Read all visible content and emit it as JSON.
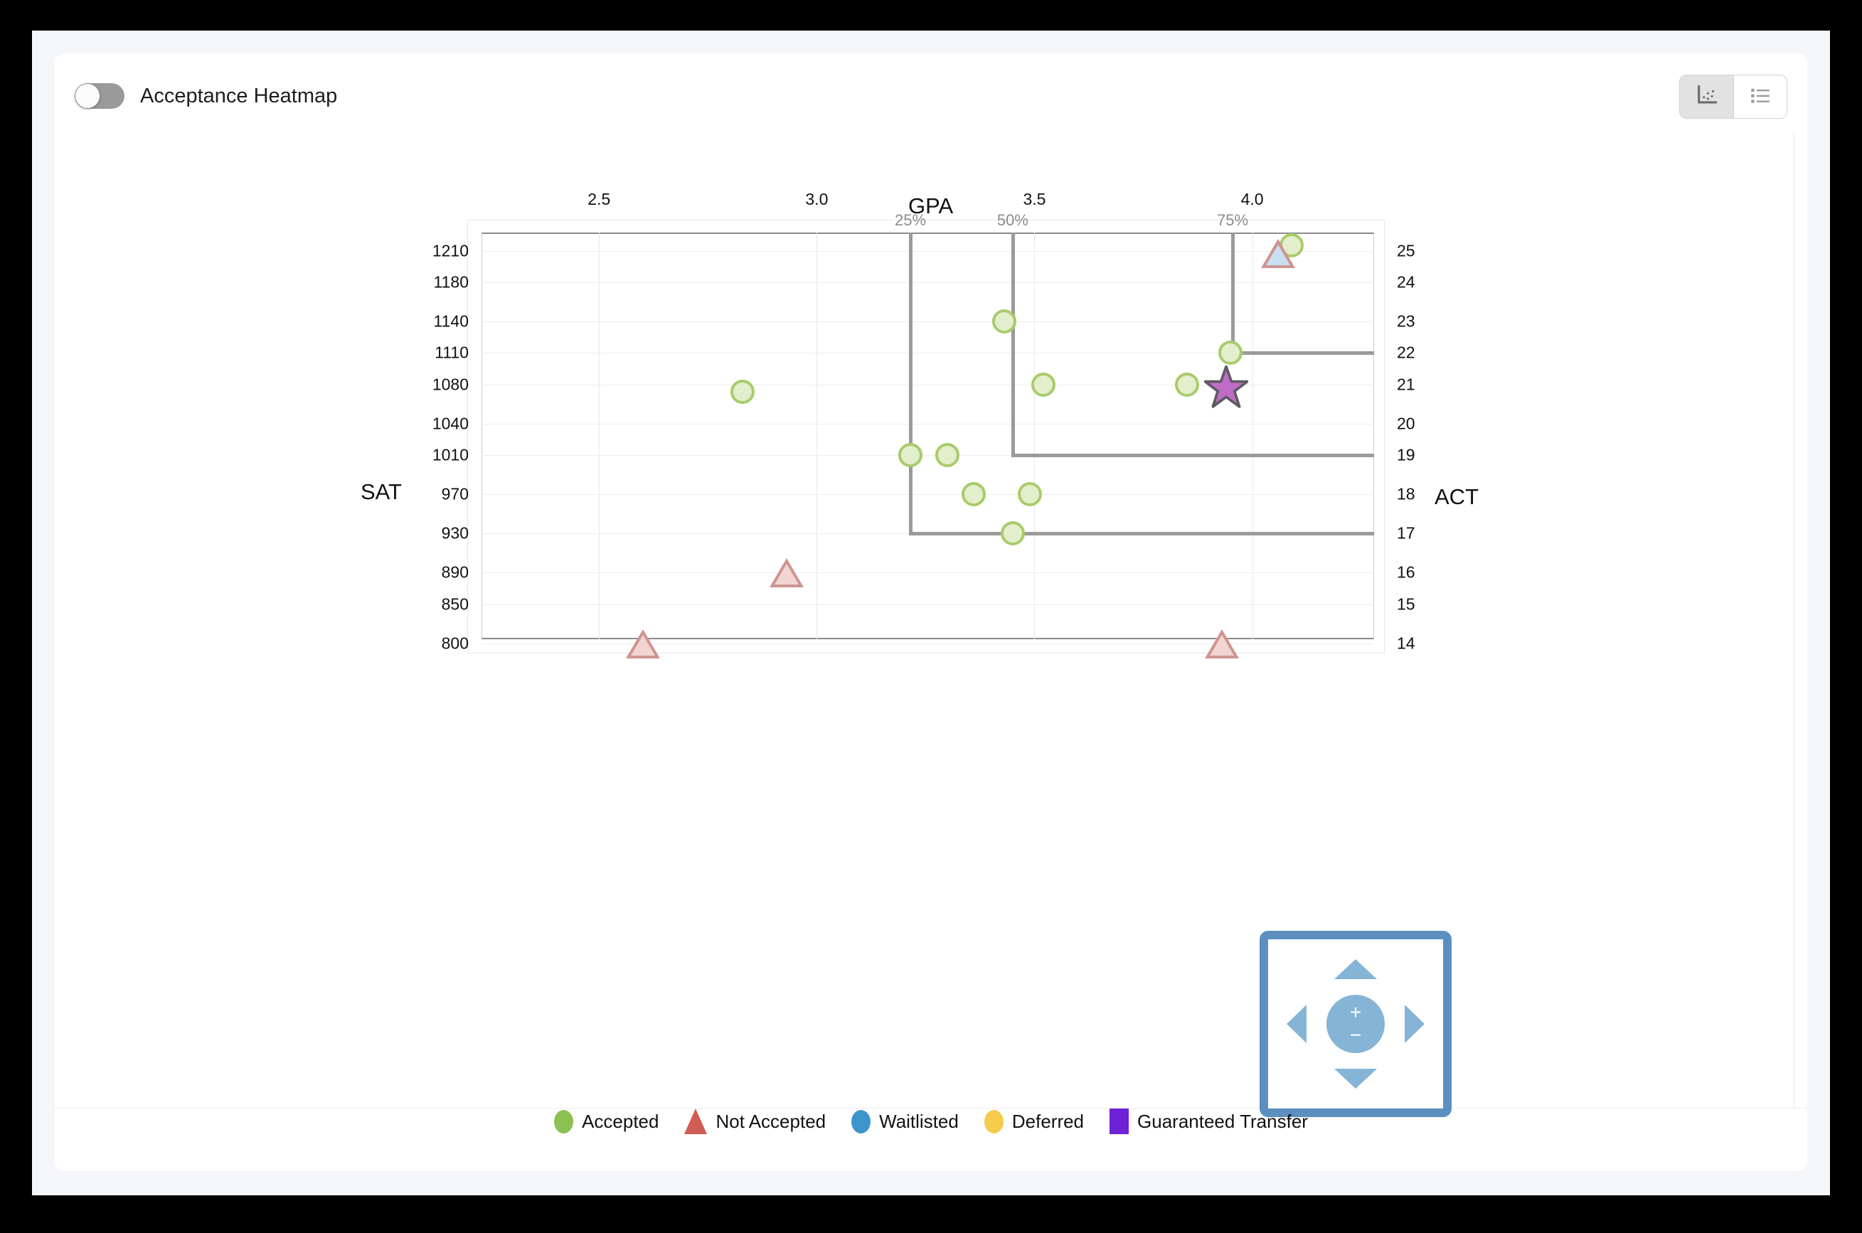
{
  "header": {
    "toggle_label": "Acceptance Heatmap",
    "toggle_state": "off",
    "view_buttons": [
      {
        "name": "scatter-view",
        "icon": "scatter-plot-icon",
        "active": true
      },
      {
        "name": "list-view",
        "icon": "list-icon",
        "active": false
      }
    ]
  },
  "legend": {
    "items": [
      {
        "label": "Accepted",
        "shape": "circle",
        "color": "#8cc152"
      },
      {
        "label": "Not Accepted",
        "shape": "triangle",
        "color": "#cf5c55"
      },
      {
        "label": "Waitlisted",
        "shape": "circle",
        "color": "#3d95cc"
      },
      {
        "label": "Deferred",
        "shape": "circle",
        "color": "#f6cb4b"
      },
      {
        "label": "Guaranteed Transfer",
        "shape": "square",
        "color": "#6e21d6"
      }
    ]
  },
  "nav_control": {
    "zoom_in_label": "+",
    "zoom_out_label": "−",
    "border_color": "#5b8fc0",
    "arrow_color": "#85b4d6"
  },
  "chart_data": {
    "type": "scatter",
    "title": "GPA",
    "xlabel": "GPA",
    "ylabel": "SAT",
    "ylabel_right": "ACT",
    "grid": true,
    "legend_position": "bottom",
    "xlim": [
      2.23,
      4.28
    ],
    "x_ticks": [
      "2.5",
      "3.0",
      "3.5",
      "4.0"
    ],
    "x_tick_values": [
      2.5,
      3.0,
      3.5,
      4.0
    ],
    "y_ticks_left": [
      "1210",
      "1180",
      "1140",
      "1110",
      "1080",
      "1040",
      "1010",
      "970",
      "930",
      "890",
      "850",
      "800"
    ],
    "y_ticks_right": [
      "25",
      "24",
      "23",
      "22",
      "21",
      "20",
      "19",
      "18",
      "17",
      "16",
      "15",
      "14"
    ],
    "y_tick_positions_pct": [
      4.5,
      12.2,
      21.8,
      29.6,
      37.4,
      47.0,
      54.8,
      64.4,
      74.0,
      83.6,
      91.4,
      101.0
    ],
    "percentile_markers": [
      {
        "label": "25%",
        "gpa": 3.215
      },
      {
        "label": "50%",
        "gpa": 3.45
      },
      {
        "label": "75%",
        "gpa": 3.955
      }
    ],
    "points": [
      {
        "gpa": 4.09,
        "sat": 1215,
        "act": 25,
        "status": "Accepted"
      },
      {
        "gpa": 4.06,
        "sat": 1208,
        "act": 25,
        "status": "Not Accepted",
        "fill": "waitlisted"
      },
      {
        "gpa": 3.43,
        "sat": 1140,
        "act": 23,
        "status": "Accepted"
      },
      {
        "gpa": 3.95,
        "sat": 1110,
        "act": 22,
        "status": "Accepted"
      },
      {
        "gpa": 3.52,
        "sat": 1080,
        "act": 21,
        "status": "Accepted"
      },
      {
        "gpa": 3.85,
        "sat": 1080,
        "act": 21,
        "status": "Accepted"
      },
      {
        "gpa": 2.83,
        "sat": 1073,
        "act": 21,
        "status": "Accepted"
      },
      {
        "gpa": 3.215,
        "sat": 1010,
        "act": 19,
        "status": "Accepted"
      },
      {
        "gpa": 3.3,
        "sat": 1010,
        "act": 19,
        "status": "Accepted"
      },
      {
        "gpa": 3.36,
        "sat": 970,
        "act": 18,
        "status": "Accepted"
      },
      {
        "gpa": 3.49,
        "sat": 970,
        "act": 18,
        "status": "Accepted"
      },
      {
        "gpa": 3.45,
        "sat": 930,
        "act": 17,
        "status": "Accepted"
      },
      {
        "gpa": 2.93,
        "sat": 890,
        "act": 16,
        "status": "Not Accepted"
      },
      {
        "gpa": 2.6,
        "sat": 800,
        "act": 14,
        "status": "Not Accepted"
      },
      {
        "gpa": 3.93,
        "sat": 800,
        "act": 14,
        "status": "Not Accepted"
      }
    ],
    "highlight_marker": {
      "gpa": 3.94,
      "sat": 1078,
      "act": 21,
      "shape": "star",
      "color": "#c06cc6"
    },
    "colors": {
      "accepted_fill": "#e3eecd",
      "accepted_stroke": "#a8cc6a",
      "not_accepted_fill": "#f2d5d3",
      "not_accepted_stroke": "#cf9491",
      "waitlisted_fill": "#c9def0",
      "star_fill": "#c06cc6",
      "star_stroke": "#5e5a63",
      "percentile_line": "#9a9a9a",
      "grid": "#ececec"
    }
  }
}
